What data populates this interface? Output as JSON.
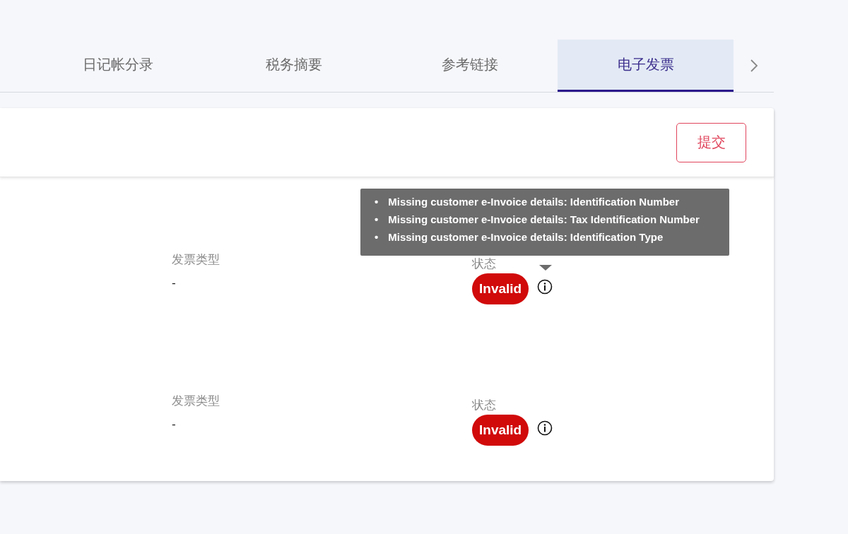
{
  "tabs": [
    {
      "label": "日记帐分录",
      "selected": false
    },
    {
      "label": "税务摘要",
      "selected": false
    },
    {
      "label": "参考链接",
      "selected": false
    },
    {
      "label": "电子发票",
      "selected": true
    }
  ],
  "submit_button": "提交",
  "records": [
    {
      "type_label": "发票类型",
      "type_value": "-",
      "status_label": "状态",
      "status": {
        "label": "Invalid",
        "kind": "invalid"
      },
      "tooltip": {
        "bullet": "•",
        "items": [
          "Missing customer e-Invoice details: Identification Number",
          "Missing customer e-Invoice details: Tax Identification Number",
          "Missing customer e-Invoice details: Identification Type"
        ]
      }
    },
    {
      "type_label": "发票类型",
      "type_value": "-",
      "status_label": "状态",
      "status": {
        "label": "Invalid",
        "kind": "invalid"
      }
    }
  ]
}
